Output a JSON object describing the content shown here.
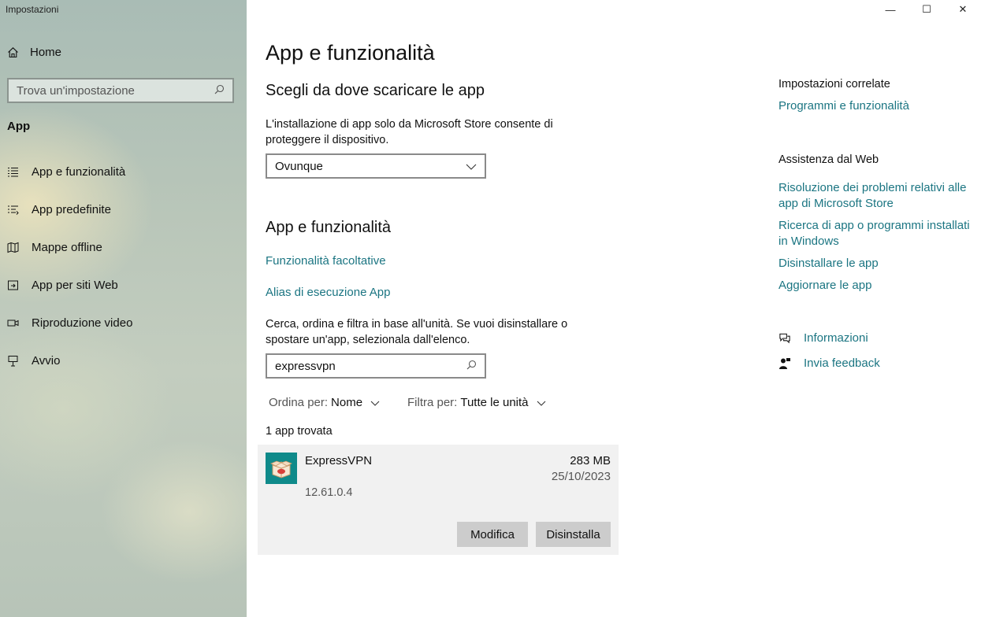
{
  "window": {
    "title": "Impostazioni",
    "minimize": "—",
    "maximize": "☐",
    "close": "✕"
  },
  "sidebar": {
    "home_label": "Home",
    "search_placeholder": "Trova un'impostazione",
    "section_title": "App",
    "items": [
      {
        "label": "App e funzionalità",
        "icon": "list-icon"
      },
      {
        "label": "App predefinite",
        "icon": "default-apps-icon"
      },
      {
        "label": "Mappe offline",
        "icon": "map-icon"
      },
      {
        "label": "App per siti Web",
        "icon": "web-app-icon"
      },
      {
        "label": "Riproduzione video",
        "icon": "video-icon"
      },
      {
        "label": "Avvio",
        "icon": "startup-icon"
      }
    ]
  },
  "main": {
    "title": "App e funzionalità",
    "source_heading": "Scegli da dove scaricare le app",
    "source_description_line1": "L'installazione di app solo da Microsoft Store consente di",
    "source_description_line2": "proteggere il dispositivo.",
    "source_dropdown_value": "Ovunque",
    "apps_heading": "App e funzionalità",
    "link_optional_features": "Funzionalità facoltative",
    "link_app_aliases": "Alias di esecuzione App",
    "filter_description_line1": "Cerca, ordina e filtra in base all'unità. Se vuoi disinstallare o",
    "filter_description_line2": "spostare un'app, selezionala dall'elenco.",
    "app_search_value": "expressvpn",
    "sort_label": "Ordina per:",
    "sort_value": "Nome",
    "filter_label": "Filtra per:",
    "filter_value": "Tutte le unità",
    "found_text": "1 app trovata",
    "app": {
      "name": "ExpressVPN",
      "version": "12.61.0.4",
      "size": "283 MB",
      "date": "25/10/2023",
      "modify_label": "Modifica",
      "uninstall_label": "Disinstalla"
    }
  },
  "right": {
    "related_heading": "Impostazioni correlate",
    "related_link": "Programmi e funzionalità",
    "web_help_heading": "Assistenza dal Web",
    "web_links": [
      "Risoluzione dei problemi relativi alle app di Microsoft Store",
      "Ricerca di app o programmi installati in Windows",
      "Disinstallare le app",
      "Aggiornare le app"
    ],
    "info_label": "Informazioni",
    "feedback_label": "Invia feedback"
  },
  "colors": {
    "accent_link": "#1b7582",
    "app_icon_bg": "#0f8a8a"
  }
}
